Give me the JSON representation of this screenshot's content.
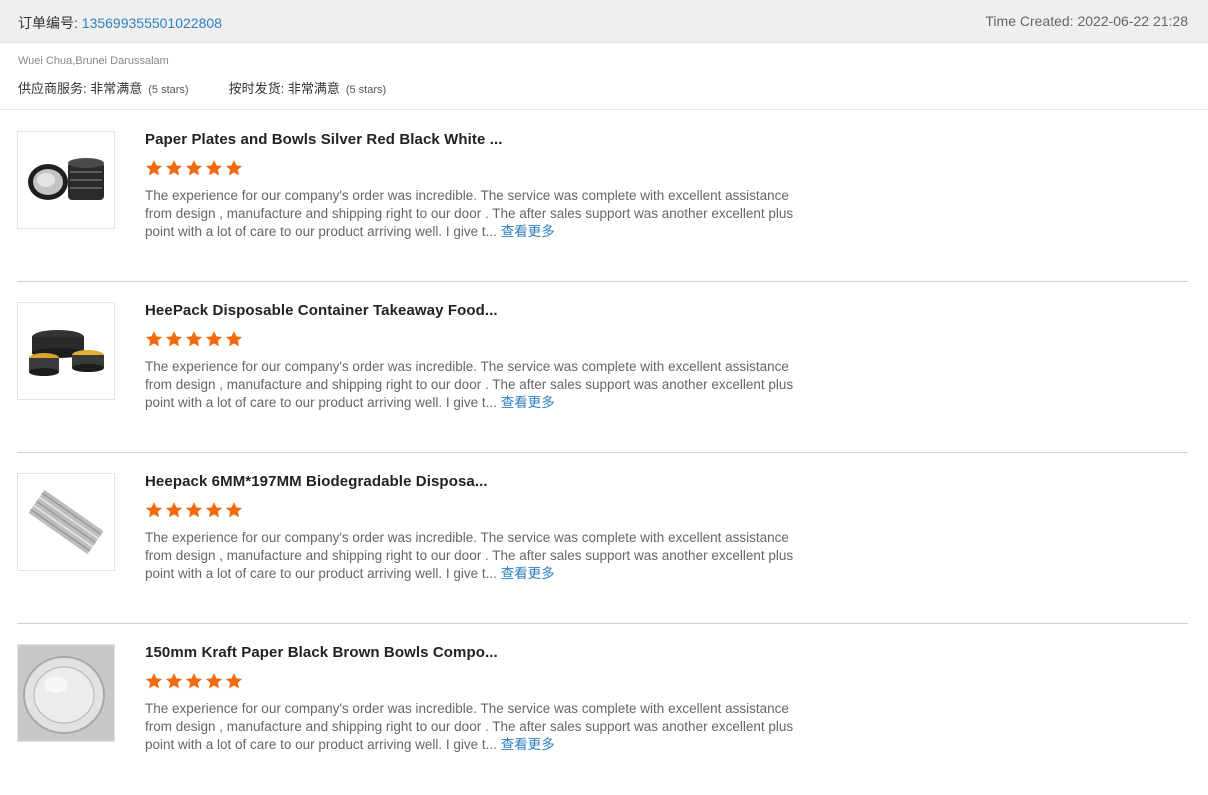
{
  "order": {
    "label": "订单编号: ",
    "number": "135699355501022808",
    "time_created": "Time Created: 2022-06-22 21:28"
  },
  "buyer": "Wuei Chua,Brunei Darussalam",
  "ratings": [
    {
      "label": "供应商服务: ",
      "value": "非常满意",
      "stars_text": "(5 stars)"
    },
    {
      "label": "按时发货: ",
      "value": "非常满意",
      "stars_text": "(5 stars)"
    }
  ],
  "star_color": "#f26a10",
  "link_color": "#2f7fc1",
  "reviews": [
    {
      "title": "Paper Plates and Bowls Silver Red Black White ...",
      "rating": 5,
      "text": "The experience for our company's order was incredible. The service was complete with excellent assistance from design , manufacture and shipping right to our door . The after sales support was another excellent plus point with a lot of care to our product arriving well. I give t...",
      "more": "查看更多",
      "image": "silver-foil-cups-image"
    },
    {
      "title": "HeePack Disposable Container Takeaway Food...",
      "rating": 5,
      "text": "The experience for our company's order was incredible. The service was complete with excellent assistance from design , manufacture and shipping right to our door . The after sales support was another excellent plus point with a lot of care to our product arriving well. I give t...",
      "more": "查看更多",
      "image": "black-gold-bowls-image"
    },
    {
      "title": "Heepack 6MM*197MM Biodegradable Disposa...",
      "rating": 5,
      "text": "The experience for our company's order was incredible. The service was complete with excellent assistance from design , manufacture and shipping right to our door . The after sales support was another excellent plus point with a lot of care to our product arriving well. I give t...",
      "more": "查看更多",
      "image": "paper-straws-image"
    },
    {
      "title": "150mm Kraft Paper Black Brown Bowls Compo...",
      "rating": 5,
      "text": "The experience for our company's order was incredible. The service was complete with excellent assistance from design , manufacture and shipping right to our door . The after sales support was another excellent plus point with a lot of care to our product arriving well. I give t...",
      "more": "查看更多",
      "image": "clear-lid-image"
    }
  ]
}
